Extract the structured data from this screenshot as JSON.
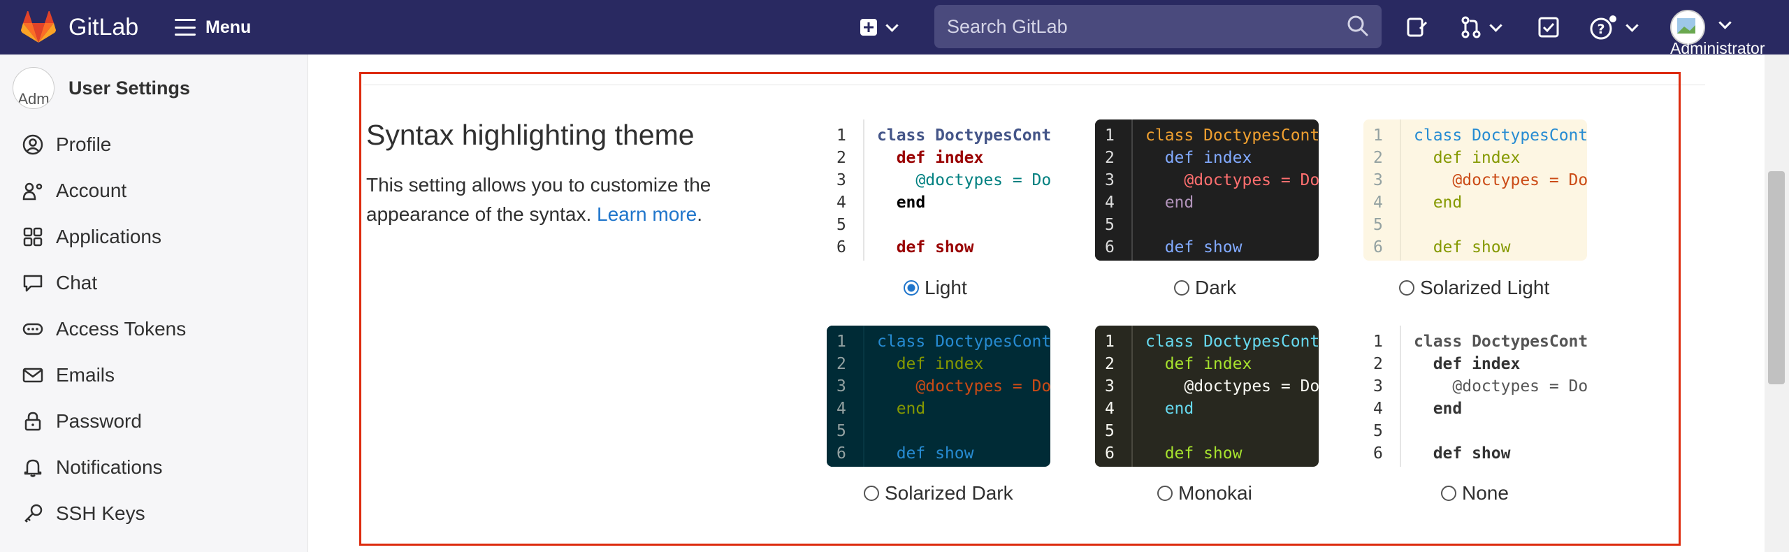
{
  "topbar": {
    "brand": "GitLab",
    "menu_label": "Menu",
    "search_placeholder": "Search GitLab",
    "user_label": "Administrator"
  },
  "sidebar": {
    "avatar_alt": "Adm",
    "title": "User Settings",
    "items": [
      {
        "label": "Profile",
        "icon": "profile-icon"
      },
      {
        "label": "Account",
        "icon": "account-icon"
      },
      {
        "label": "Applications",
        "icon": "applications-icon"
      },
      {
        "label": "Chat",
        "icon": "chat-icon"
      },
      {
        "label": "Access Tokens",
        "icon": "token-icon"
      },
      {
        "label": "Emails",
        "icon": "mail-icon"
      },
      {
        "label": "Password",
        "icon": "lock-icon"
      },
      {
        "label": "Notifications",
        "icon": "bell-icon"
      },
      {
        "label": "SSH Keys",
        "icon": "key-icon"
      }
    ]
  },
  "section": {
    "title": "Syntax highlighting theme",
    "description": "This setting allows you to customize the appearance of the syntax.",
    "learn_more": "Learn more",
    "period": "."
  },
  "code_sample": {
    "line_numbers": [
      "1",
      "2",
      "3",
      "4",
      "5",
      "6"
    ],
    "lines": [
      "class DoctypesController",
      "  def index",
      "    @doctypes = Doctype.all",
      "  end",
      "",
      "  def show"
    ]
  },
  "themes": [
    {
      "name": "Light",
      "selected": true
    },
    {
      "name": "Dark",
      "selected": false
    },
    {
      "name": "Solarized Light",
      "selected": false
    },
    {
      "name": "Solarized Dark",
      "selected": false
    },
    {
      "name": "Monokai",
      "selected": false
    },
    {
      "name": "None",
      "selected": false
    }
  ],
  "colors": {
    "topbar": "#292961",
    "search_bg": "#4a4a7d",
    "link": "#1f75cb",
    "highlight_box": "#dd2b0e"
  }
}
